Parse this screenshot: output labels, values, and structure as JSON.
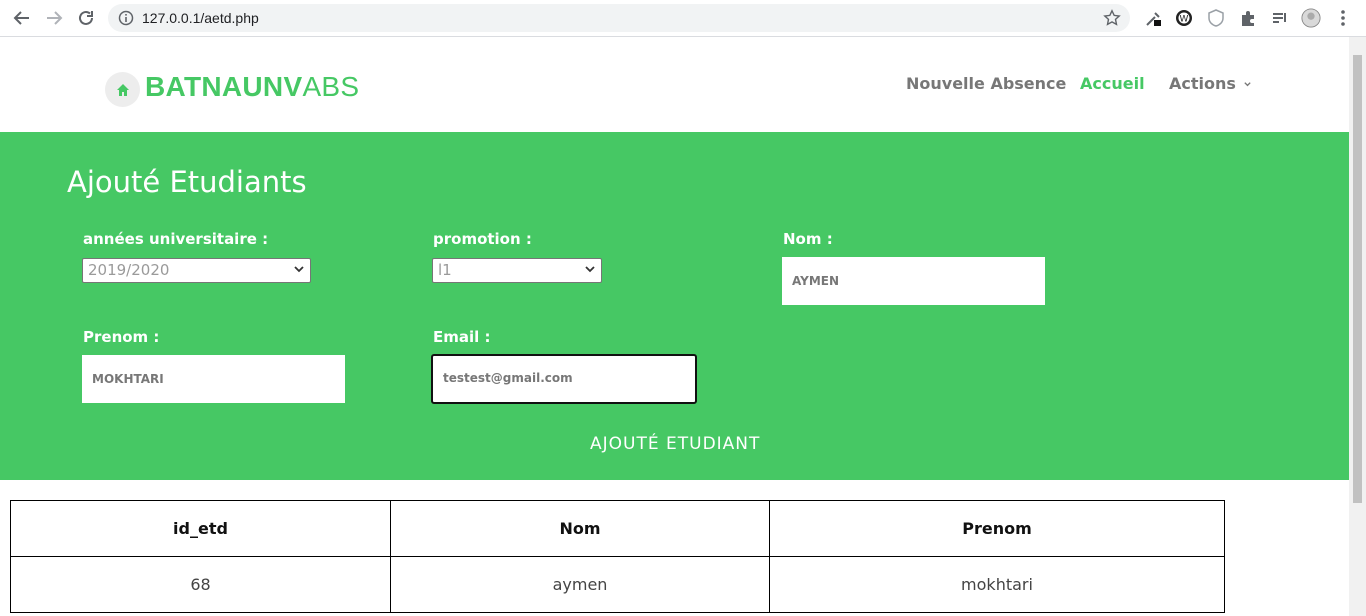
{
  "browser": {
    "url": "127.0.0.1/aetd.php"
  },
  "header": {
    "logo_bold": "BATNAUNV",
    "logo_light": "ABS",
    "nav": [
      {
        "label": "Nouvelle Absence"
      },
      {
        "label": "Accueil"
      },
      {
        "label": "Actions"
      }
    ]
  },
  "form": {
    "title": "Ajouté Etudiants",
    "annee_label": "années universitaire :",
    "annee_value": "2019/2020",
    "promotion_label": "promotion :",
    "promotion_value": "l1",
    "nom_label": "Nom :",
    "nom_value": "AYMEN",
    "prenom_label": "Prenom :",
    "prenom_value": "MOKHTARI",
    "email_label": "Email :",
    "email_value": "testest@gmail.com",
    "submit_label": "AJOUTÉ ETUDIANT"
  },
  "table": {
    "headers": [
      "id_etd",
      "Nom",
      "Prenom"
    ],
    "rows": [
      [
        "68",
        "aymen",
        "mokhtari"
      ]
    ]
  },
  "colors": {
    "accent": "#46c864",
    "nav_text": "#777777"
  }
}
